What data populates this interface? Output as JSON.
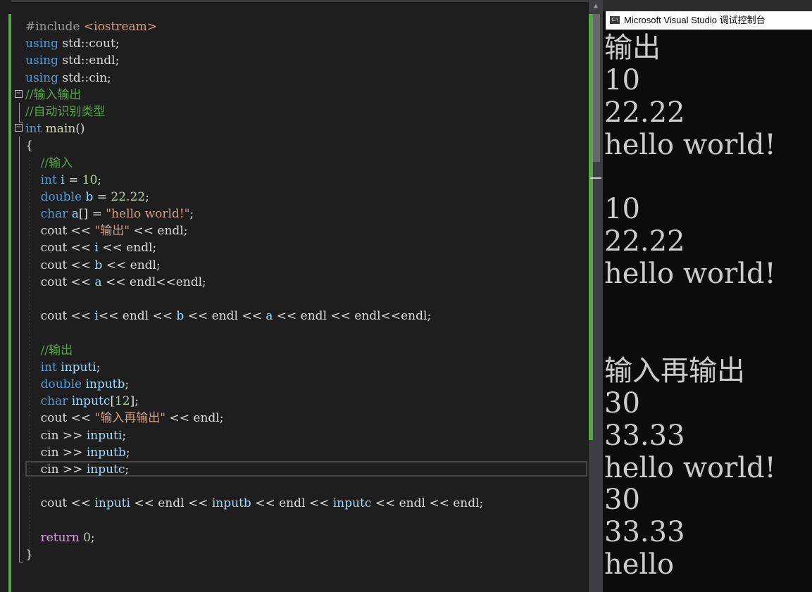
{
  "editor": {
    "lines": [
      [
        {
          "c": "pp",
          "t": "#include "
        },
        {
          "c": "str",
          "t": "<iostream>"
        }
      ],
      [
        {
          "c": "kw",
          "t": "using "
        },
        {
          "c": "plain",
          "t": "std::cout;"
        }
      ],
      [
        {
          "c": "kw",
          "t": "using "
        },
        {
          "c": "plain",
          "t": "std::endl;"
        }
      ],
      [
        {
          "c": "kw",
          "t": "using "
        },
        {
          "c": "plain",
          "t": "std::cin;"
        }
      ],
      [
        {
          "c": "cm",
          "t": "//输入输出"
        }
      ],
      [
        {
          "c": "cm",
          "t": "//自动识别类型"
        }
      ],
      [
        {
          "c": "kw",
          "t": "int "
        },
        {
          "c": "fn",
          "t": "main"
        },
        {
          "c": "plain",
          "t": "()"
        }
      ],
      [
        {
          "c": "plain",
          "t": "{"
        }
      ],
      [
        {
          "c": "cm",
          "t": "    //输入"
        }
      ],
      [
        {
          "c": "kw",
          "t": "    int "
        },
        {
          "c": "var",
          "t": "i"
        },
        {
          "c": "plain",
          "t": " = "
        },
        {
          "c": "num",
          "t": "10"
        },
        {
          "c": "plain",
          "t": ";"
        }
      ],
      [
        {
          "c": "kw",
          "t": "    double "
        },
        {
          "c": "var",
          "t": "b"
        },
        {
          "c": "plain",
          "t": " = "
        },
        {
          "c": "num",
          "t": "22.22"
        },
        {
          "c": "plain",
          "t": ";"
        }
      ],
      [
        {
          "c": "kw",
          "t": "    char "
        },
        {
          "c": "var",
          "t": "a"
        },
        {
          "c": "plain",
          "t": "[] = "
        },
        {
          "c": "str",
          "t": "\"hello world!\""
        },
        {
          "c": "plain",
          "t": ";"
        }
      ],
      [
        {
          "c": "plain",
          "t": "    cout << "
        },
        {
          "c": "str",
          "t": "\"输出\""
        },
        {
          "c": "plain",
          "t": " << endl;"
        }
      ],
      [
        {
          "c": "plain",
          "t": "    cout << "
        },
        {
          "c": "var",
          "t": "i"
        },
        {
          "c": "plain",
          "t": " << endl;"
        }
      ],
      [
        {
          "c": "plain",
          "t": "    cout << "
        },
        {
          "c": "var",
          "t": "b"
        },
        {
          "c": "plain",
          "t": " << endl;"
        }
      ],
      [
        {
          "c": "plain",
          "t": "    cout << "
        },
        {
          "c": "var",
          "t": "a"
        },
        {
          "c": "plain",
          "t": " << endl<<endl;"
        }
      ],
      [],
      [
        {
          "c": "plain",
          "t": "    cout << "
        },
        {
          "c": "var",
          "t": "i"
        },
        {
          "c": "plain",
          "t": "<< endl << "
        },
        {
          "c": "var",
          "t": "b"
        },
        {
          "c": "plain",
          "t": " << endl << "
        },
        {
          "c": "var",
          "t": "a"
        },
        {
          "c": "plain",
          "t": " << endl << endl<<endl;"
        }
      ],
      [],
      [
        {
          "c": "cm",
          "t": "    //输出"
        }
      ],
      [
        {
          "c": "kw",
          "t": "    int "
        },
        {
          "c": "var",
          "t": "inputi"
        },
        {
          "c": "plain",
          "t": ";"
        }
      ],
      [
        {
          "c": "kw",
          "t": "    double "
        },
        {
          "c": "var",
          "t": "inputb"
        },
        {
          "c": "plain",
          "t": ";"
        }
      ],
      [
        {
          "c": "kw",
          "t": "    char "
        },
        {
          "c": "var",
          "t": "inputc"
        },
        {
          "c": "plain",
          "t": "["
        },
        {
          "c": "num",
          "t": "12"
        },
        {
          "c": "plain",
          "t": "];"
        }
      ],
      [
        {
          "c": "plain",
          "t": "    cout << "
        },
        {
          "c": "str",
          "t": "\"输入再输出\""
        },
        {
          "c": "plain",
          "t": " << endl;"
        }
      ],
      [
        {
          "c": "plain",
          "t": "    cin >> "
        },
        {
          "c": "var",
          "t": "inputi"
        },
        {
          "c": "plain",
          "t": ";"
        }
      ],
      [
        {
          "c": "plain",
          "t": "    cin >> "
        },
        {
          "c": "var",
          "t": "inputb"
        },
        {
          "c": "plain",
          "t": ";"
        }
      ],
      [
        {
          "c": "plain",
          "t": "    cin >> "
        },
        {
          "c": "var",
          "t": "inputc"
        },
        {
          "c": "plain",
          "t": ";"
        }
      ],
      [],
      [
        {
          "c": "plain",
          "t": "    cout << "
        },
        {
          "c": "var",
          "t": "inputi"
        },
        {
          "c": "plain",
          "t": " << endl << "
        },
        {
          "c": "var",
          "t": "inputb"
        },
        {
          "c": "plain",
          "t": " << endl << "
        },
        {
          "c": "var",
          "t": "inputc"
        },
        {
          "c": "plain",
          "t": " << endl << endl;"
        }
      ],
      [],
      [
        {
          "c": "ret",
          "t": "    return "
        },
        {
          "c": "num",
          "t": "0"
        },
        {
          "c": "plain",
          "t": ";"
        }
      ],
      [
        {
          "c": "plain",
          "t": "}"
        }
      ]
    ],
    "collapse_symbol": "−"
  },
  "console": {
    "title": "Microsoft Visual Studio 调试控制台",
    "icon": "console-app-icon",
    "icon_text": "C:\\",
    "output": [
      "输出",
      "10",
      "22.22",
      "hello world!",
      "",
      "10",
      "22.22",
      "hello world!",
      "",
      "",
      "输入再输出",
      "30",
      "33.33",
      "hello world!",
      "30",
      "33.33",
      "hello"
    ]
  },
  "colors": {
    "editor_bg": "#1e1e1e",
    "keyword": "#569cd6",
    "comment": "#57a64a",
    "string": "#d69d85",
    "number": "#b5cea8",
    "console_bg": "#0c0c0c",
    "console_fg": "#cccccc"
  }
}
